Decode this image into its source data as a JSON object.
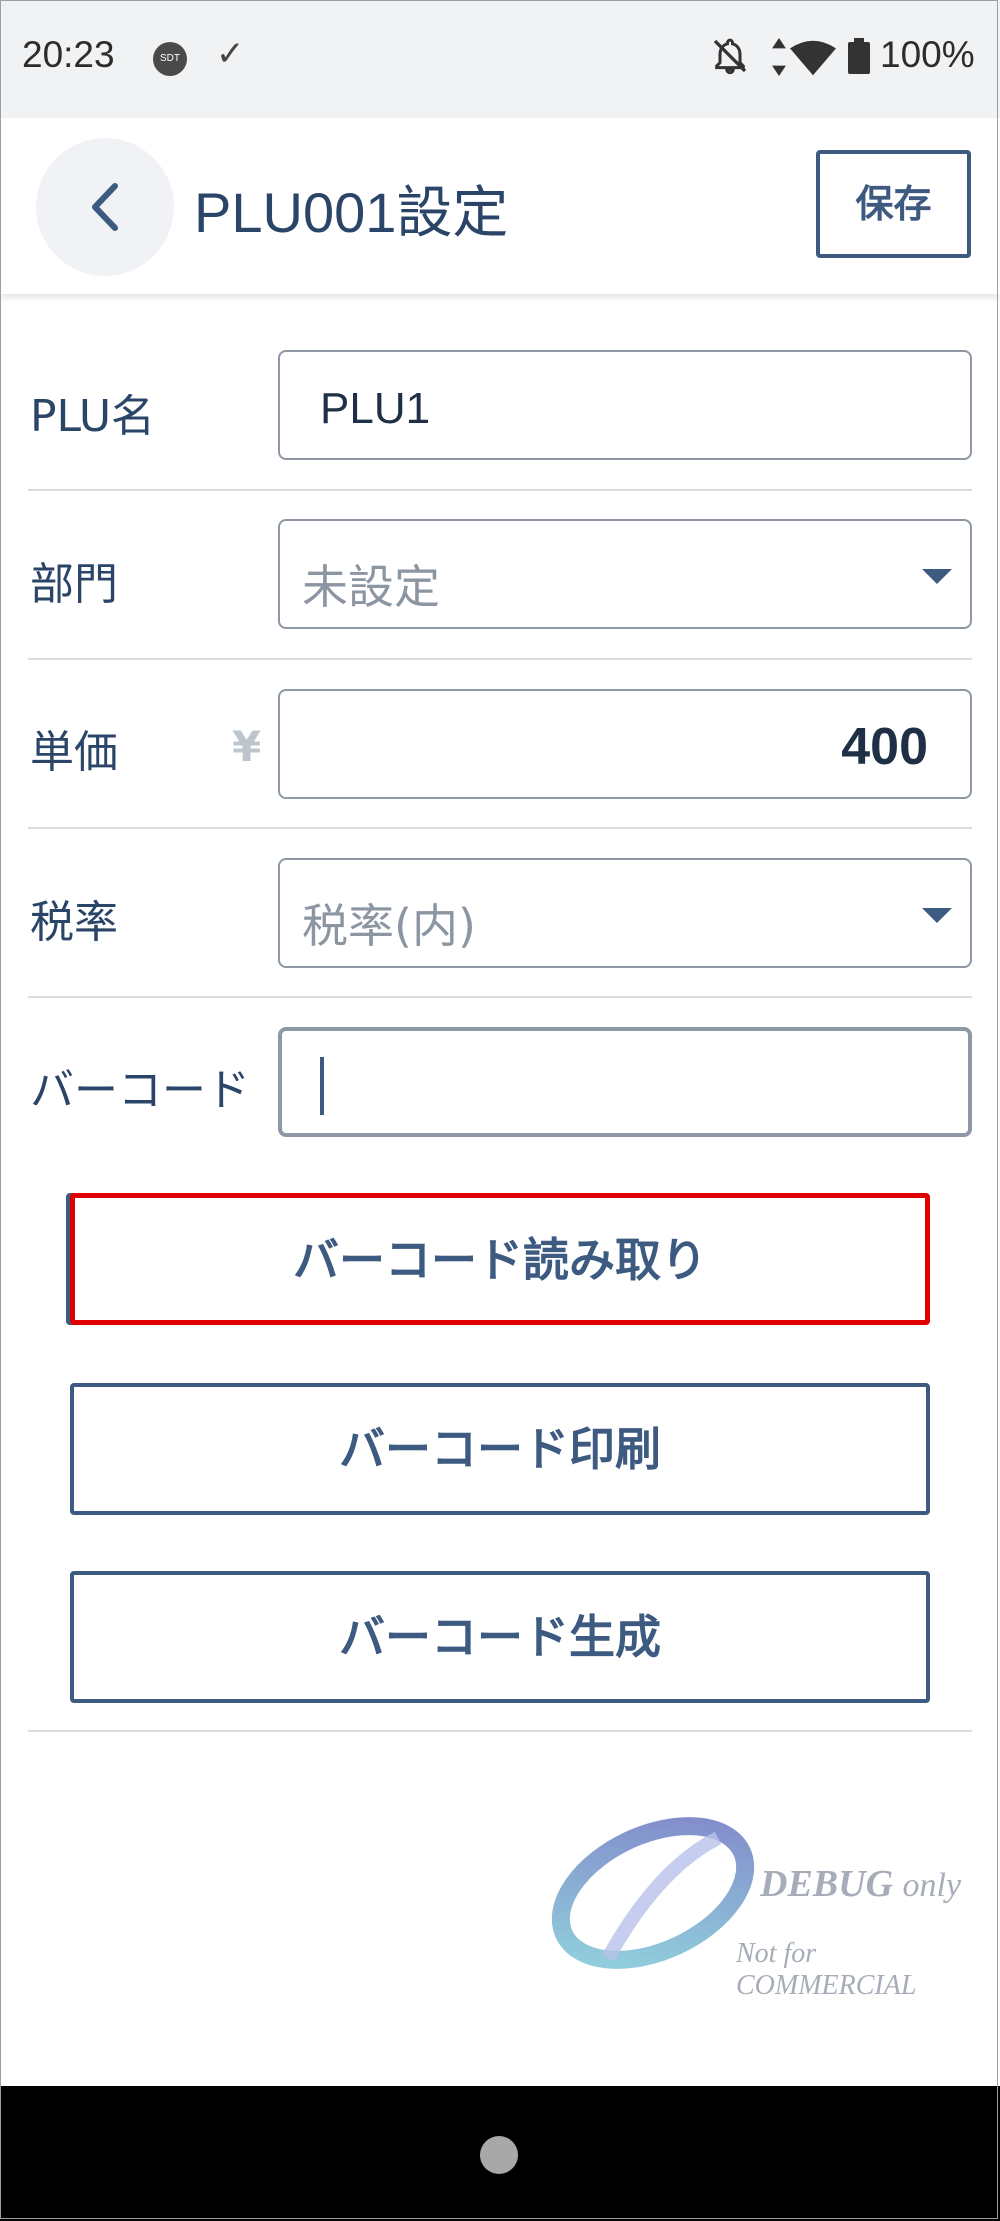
{
  "status_bar": {
    "time": "20:23",
    "sdt_badge": "SDT",
    "check": "✓",
    "battery_percent": "100%"
  },
  "header": {
    "title": "PLU001設定",
    "save_label": "保存"
  },
  "form": {
    "plu_name": {
      "label": "PLU名",
      "value": "PLU1"
    },
    "department": {
      "label": "部門",
      "selected": "未設定"
    },
    "unit_price": {
      "label": "単価",
      "currency_symbol": "¥",
      "value": "400"
    },
    "tax_rate": {
      "label": "税率",
      "selected": "税率(内)"
    },
    "barcode": {
      "label": "バーコード",
      "value": ""
    }
  },
  "actions": {
    "read_barcode": "バーコード読み取り",
    "print_barcode": "バーコード印刷",
    "generate_barcode": "バーコード生成"
  },
  "watermark": {
    "debug": "DEBUG",
    "only": "only",
    "not_for": "Not for COMMERCIAL"
  },
  "colors": {
    "accent": "#3d5a80",
    "highlight": "#e00000",
    "statusbar_bg": "#f1f2f4",
    "navbar_bg": "#000000"
  }
}
